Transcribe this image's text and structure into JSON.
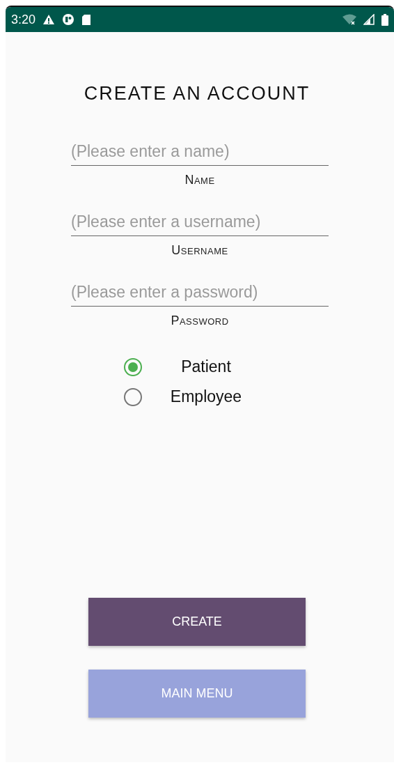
{
  "status_bar": {
    "time": "3:20"
  },
  "title": "CREATE AN ACCOUNT",
  "fields": [
    {
      "placeholder": "(Please enter a name)",
      "label": "Name"
    },
    {
      "placeholder": "(Please enter a username)",
      "label": "Username"
    },
    {
      "placeholder": "(Please enter a password)",
      "label": "Password"
    }
  ],
  "roles": [
    {
      "label": "Patient",
      "selected": true
    },
    {
      "label": "Employee",
      "selected": false
    }
  ],
  "buttons": [
    {
      "label": "CREATE",
      "kind": "primary"
    },
    {
      "label": "MAIN MENU",
      "kind": "secondary"
    }
  ]
}
